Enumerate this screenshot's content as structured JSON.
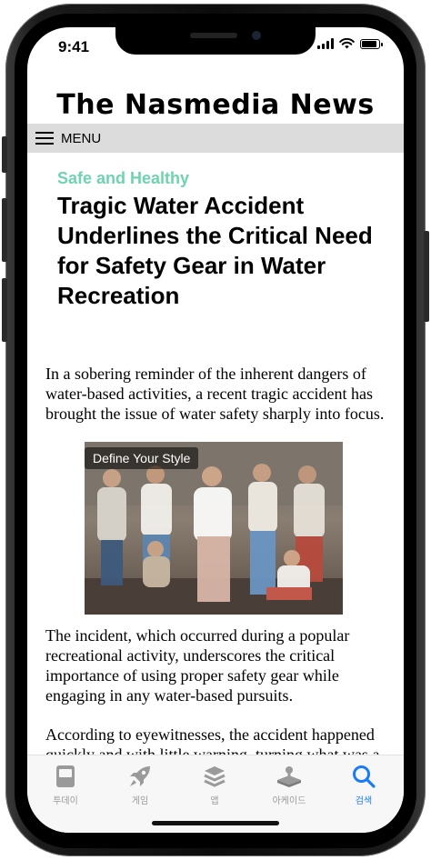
{
  "status_bar": {
    "time": "9:41"
  },
  "masthead": {
    "title": "The Nasmedia News"
  },
  "menu": {
    "label": "MENU"
  },
  "article": {
    "category": "Safe and Healthy",
    "headline": "Tragic Water Accident Underlines the Critical Need for Safety Gear in Water Recreation",
    "paragraphs": [
      "In a sobering reminder of the inherent dangers of water-based activities, a recent tragic accident has brought the issue of water safety sharply into focus.",
      "The incident, which occurred during a popular recreational activity, underscores the critical importance of using proper safety gear while engaging in any water-based pursuits.",
      "According to eyewitnesses, the accident happened quickly and with little warning, turning what was a joyful day into a somber tragedy."
    ]
  },
  "ad": {
    "label": "Define Your Style"
  },
  "tabbar": {
    "tabs": [
      {
        "label": "투데이",
        "icon": "today-icon",
        "active": false
      },
      {
        "label": "게임",
        "icon": "rocket-icon",
        "active": false
      },
      {
        "label": "앱",
        "icon": "stack-icon",
        "active": false
      },
      {
        "label": "아케이드",
        "icon": "arcade-icon",
        "active": false
      },
      {
        "label": "검색",
        "icon": "search-icon",
        "active": true
      }
    ]
  },
  "colors": {
    "category": "#6fd3b0",
    "active_tab": "#1a7cf5",
    "menu_bar": "#dcdcdc"
  }
}
